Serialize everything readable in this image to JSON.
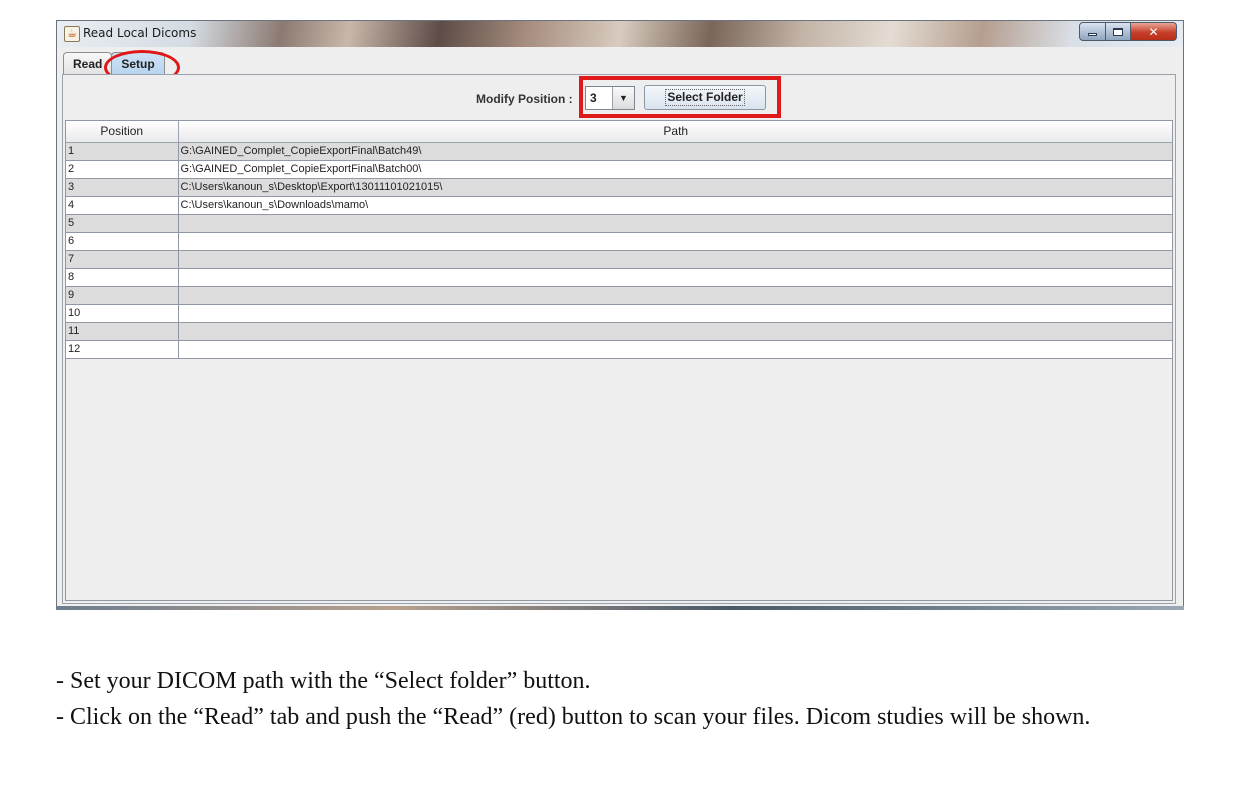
{
  "window": {
    "title": "Read Local Dicoms",
    "icon": "java-icon",
    "controls": [
      "minimize-icon",
      "maximize-icon",
      "close-icon"
    ]
  },
  "tabs": [
    {
      "label": "Read",
      "selected": false
    },
    {
      "label": "Setup",
      "selected": true
    }
  ],
  "toolbar": {
    "modify_label": "Modify Position :",
    "position_value": "3",
    "select_folder_label": "Select Folder"
  },
  "table": {
    "headers": [
      "Position",
      "Path"
    ],
    "rows": [
      {
        "position": "1",
        "path": "G:\\GAINED_Complet_CopieExportFinal\\Batch49\\"
      },
      {
        "position": "2",
        "path": "G:\\GAINED_Complet_CopieExportFinal\\Batch00\\"
      },
      {
        "position": "3",
        "path": "C:\\Users\\kanoun_s\\Desktop\\Export\\13011101021015\\"
      },
      {
        "position": "4",
        "path": "C:\\Users\\kanoun_s\\Downloads\\mamo\\"
      },
      {
        "position": "5",
        "path": ""
      },
      {
        "position": "6",
        "path": ""
      },
      {
        "position": "7",
        "path": ""
      },
      {
        "position": "8",
        "path": ""
      },
      {
        "position": "9",
        "path": ""
      },
      {
        "position": "10",
        "path": ""
      },
      {
        "position": "11",
        "path": ""
      },
      {
        "position": "12",
        "path": ""
      }
    ]
  },
  "instructions": {
    "line1": "- Set your DICOM path with the “Select folder” button.",
    "line2": "- Click on the “Read” tab and push the “Read” (red) button to scan your files. Dicom studies will be shown."
  },
  "colors": {
    "highlight": "#e01a1a",
    "row_alt": "#dcdcdc",
    "selected_tab": "#b8d4ef"
  }
}
